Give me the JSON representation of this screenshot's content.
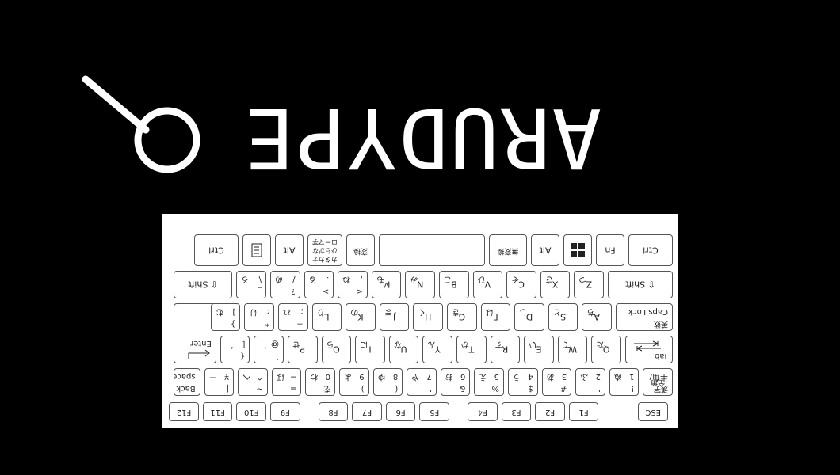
{
  "logo": {
    "text": "ARUDYPE"
  },
  "colors": {
    "background": "#000000",
    "logo": "#ffffff",
    "keyboard": "#ffffff",
    "key_border": "#555555"
  },
  "keyboard": {
    "function_row": [
      {
        "id": "esc",
        "label": "ESC"
      },
      {
        "id": "f1",
        "label": "F1"
      },
      {
        "id": "f2",
        "label": "F2"
      },
      {
        "id": "f3",
        "label": "F3"
      },
      {
        "id": "f4",
        "label": "F4"
      },
      {
        "id": "f5",
        "label": "F5"
      },
      {
        "id": "f6",
        "label": "F6"
      },
      {
        "id": "f7",
        "label": "F7"
      },
      {
        "id": "f8",
        "label": "F8"
      },
      {
        "id": "f9",
        "label": "F9"
      },
      {
        "id": "f10",
        "label": "F10"
      },
      {
        "id": "f11",
        "label": "F11"
      },
      {
        "id": "f12",
        "label": "F12"
      }
    ],
    "number_row": [
      {
        "id": "hankaku",
        "main": "半角/",
        "sub": "全角",
        "sub2": "漢字"
      },
      {
        "id": "n1",
        "top": "!",
        "bottom": "1",
        "kana": "ぬ"
      },
      {
        "id": "n2",
        "top": "\"",
        "bottom": "2",
        "kana": "ふ"
      },
      {
        "id": "n3",
        "top": "#",
        "bottom": "3",
        "kana": "あ"
      },
      {
        "id": "n4",
        "top": "$",
        "bottom": "4",
        "kana": "う"
      },
      {
        "id": "n5",
        "top": "%",
        "bottom": "5",
        "kana": "え"
      },
      {
        "id": "n6",
        "top": "&",
        "bottom": "6",
        "kana": "お"
      },
      {
        "id": "n7",
        "top": "'",
        "bottom": "7",
        "kana": "や"
      },
      {
        "id": "n8",
        "top": "(",
        "bottom": "8",
        "kana": "ゆ"
      },
      {
        "id": "n9",
        "top": ")",
        "bottom": "9",
        "kana": "よ"
      },
      {
        "id": "n0",
        "top": "を",
        "bottom": "0",
        "kana": "わ"
      },
      {
        "id": "minus",
        "top": "=",
        "bottom": "−",
        "kana": "ほ"
      },
      {
        "id": "caret",
        "top": "~",
        "bottom": "^",
        "kana": "へ"
      },
      {
        "id": "yen",
        "top": "|",
        "bottom": "¥",
        "kana": "ー"
      },
      {
        "id": "backspace",
        "main": "Back",
        "sub": "space"
      }
    ],
    "top_row": [
      {
        "id": "tab",
        "label": "Tab"
      },
      {
        "id": "q",
        "label": "Q",
        "kana": "た"
      },
      {
        "id": "w",
        "label": "W",
        "kana": "て"
      },
      {
        "id": "e",
        "label": "E",
        "kana": "い"
      },
      {
        "id": "r",
        "label": "R",
        "kana": "す"
      },
      {
        "id": "t",
        "label": "T",
        "kana": "か"
      },
      {
        "id": "y",
        "label": "Y",
        "kana": "ん"
      },
      {
        "id": "u",
        "label": "U",
        "kana": "な"
      },
      {
        "id": "i",
        "label": "I",
        "kana": "に"
      },
      {
        "id": "o",
        "label": "O",
        "kana": "ら"
      },
      {
        "id": "p",
        "label": "P",
        "kana": "せ"
      },
      {
        "id": "at",
        "top": "`",
        "bottom": "@",
        "kana": "゛"
      },
      {
        "id": "lbracket",
        "top": "{",
        "bottom": "[",
        "kana": "゜"
      },
      {
        "id": "enter",
        "label": "Enter"
      }
    ],
    "home_row": [
      {
        "id": "caps",
        "main": "Caps Lock",
        "sub": "英数"
      },
      {
        "id": "a",
        "label": "A",
        "kana": "ち"
      },
      {
        "id": "s",
        "label": "S",
        "kana": "と"
      },
      {
        "id": "d",
        "label": "D",
        "kana": "し"
      },
      {
        "id": "f",
        "label": "F",
        "kana": "は"
      },
      {
        "id": "g",
        "label": "G",
        "kana": "き"
      },
      {
        "id": "h",
        "label": "H",
        "kana": "く"
      },
      {
        "id": "j",
        "label": "J",
        "kana": "ま"
      },
      {
        "id": "k",
        "label": "K",
        "kana": "の"
      },
      {
        "id": "l",
        "label": "L",
        "kana": "り"
      },
      {
        "id": "semicolon",
        "top": "+",
        "bottom": ";",
        "kana": "れ"
      },
      {
        "id": "colon",
        "top": "*",
        "bottom": ":",
        "kana": "け"
      },
      {
        "id": "rbracket",
        "top": "}",
        "bottom": "]",
        "kana": "む"
      }
    ],
    "bottom_row": [
      {
        "id": "lshift",
        "label": "⇧ Shift"
      },
      {
        "id": "z",
        "label": "Z",
        "kana": "つ"
      },
      {
        "id": "x",
        "label": "X",
        "kana": "さ"
      },
      {
        "id": "c",
        "label": "C",
        "kana": "そ"
      },
      {
        "id": "v",
        "label": "V",
        "kana": "ひ"
      },
      {
        "id": "b",
        "label": "B",
        "kana": "こ"
      },
      {
        "id": "n",
        "label": "N",
        "kana": "み"
      },
      {
        "id": "m",
        "label": "M",
        "kana": "も"
      },
      {
        "id": "comma",
        "top": "<",
        "bottom": ",",
        "kana": "ね"
      },
      {
        "id": "period",
        "top": ">",
        "bottom": ".",
        "kana": "る"
      },
      {
        "id": "slash",
        "top": "?",
        "bottom": "/",
        "kana": "め"
      },
      {
        "id": "backslash",
        "top": "_",
        "bottom": "\\",
        "kana": "ろ"
      },
      {
        "id": "rshift",
        "label": "⇧ Shift"
      }
    ],
    "space_row": [
      {
        "id": "lctrl",
        "label": "Ctrl"
      },
      {
        "id": "fn",
        "label": "Fn"
      },
      {
        "id": "win",
        "icon": "windows-icon"
      },
      {
        "id": "lalt",
        "label": "Alt"
      },
      {
        "id": "muhenkan",
        "label": "無変換"
      },
      {
        "id": "space",
        "label": ""
      },
      {
        "id": "henkan",
        "label": "変換"
      },
      {
        "id": "kana",
        "main": "カタカナ",
        "sub": "ひらがな",
        "sub2": "ローマ字"
      },
      {
        "id": "ralt",
        "label": "Alt"
      },
      {
        "id": "menu",
        "icon": "menu-icon"
      },
      {
        "id": "rctrl",
        "label": "Ctrl"
      }
    ]
  }
}
